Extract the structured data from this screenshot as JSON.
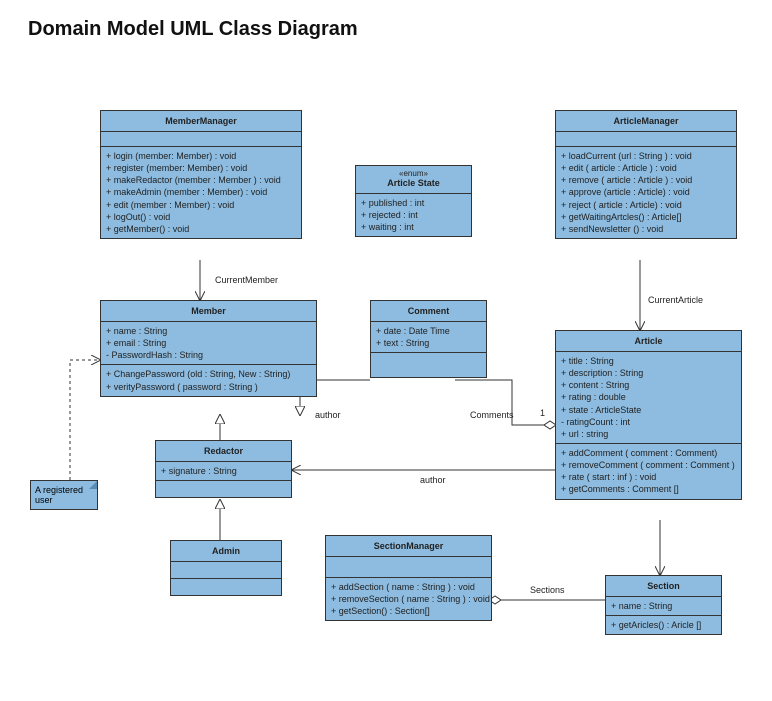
{
  "title": "Domain Model UML Class Diagram",
  "note": {
    "text": "A registered user"
  },
  "labels": {
    "currentMember": "CurrentMember",
    "currentArticle": "CurrentArticle",
    "author1": "author",
    "author2": "author",
    "comments": "Comments",
    "one": "1",
    "sections": "Sections"
  },
  "memberManager": {
    "name": "MemberManager",
    "ops": [
      "+  login (member: Member) : void",
      "+  register (member:  Member) : void",
      "+  makeRedactor (member : Member ) : void",
      "+  makeAdmin (member : Member) : void",
      "+  edit (member : Member) : void",
      "+  logOut() : void",
      "+  getMember() : void"
    ]
  },
  "articleState": {
    "stereo": "«enum»",
    "name": "Article State",
    "attrs": [
      "+  published : int",
      "+  rejected : int",
      "+  waiting : int"
    ]
  },
  "articleManager": {
    "name": "ArticleManager",
    "ops": [
      "+ loadCurrent (url : String ) : void",
      "+ edit ( article : Article ) : void",
      "+ remove ( article : Article ) : void",
      "+ approve (article : Article) : void",
      "+ reject ( article : Article) : void",
      "+ getWaitingArtcles() : Article[]",
      "+ sendNewsletter () : void"
    ]
  },
  "member": {
    "name": "Member",
    "attrs": [
      "+ name : String",
      "+ email : String",
      "-  PasswordHash : String"
    ],
    "ops": [
      "+  ChangePassword (old : String, New : String)",
      "+  verityPassword ( password : String )"
    ]
  },
  "comment": {
    "name": "Comment",
    "attrs": [
      "+  date : Date Time",
      "+  text : String"
    ]
  },
  "article": {
    "name": "Article",
    "attrs": [
      "+  title : String",
      "+  description : String",
      "+  content : String",
      "+  rating : double",
      "+  state : ArticleState",
      "-   ratingCount : int",
      "+  url : string"
    ],
    "ops": [
      "+ addComment ( comment : Comment)",
      "+ removeComment ( comment : Comment )",
      "+ rate ( start : inf ) : void",
      "+ getComments : Comment []"
    ]
  },
  "redactor": {
    "name": "Redactor",
    "attrs": [
      "+ signature : String"
    ]
  },
  "admin": {
    "name": "Admin"
  },
  "sectionManager": {
    "name": "SectionManager",
    "ops": [
      "+ addSection ( name : String ) : void",
      "+ removeSection ( name : String ) : void",
      "+ getSection() : Section[]"
    ]
  },
  "section": {
    "name": "Section",
    "attrs": [
      "+ name : String"
    ],
    "ops": [
      "+ getAricles() : Aricle []"
    ]
  }
}
